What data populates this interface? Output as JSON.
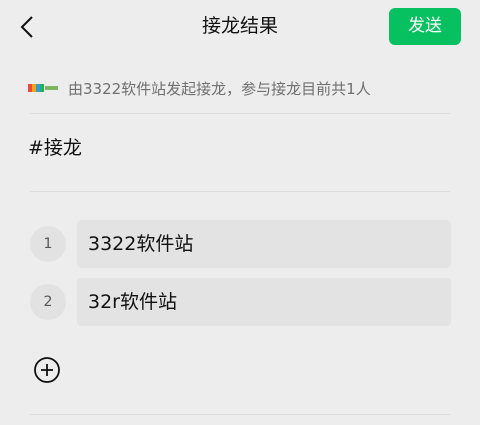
{
  "nav": {
    "title": "接龙结果",
    "send_label": "发送"
  },
  "info": {
    "logo_icon": "3322-logo-icon",
    "text": "由3322软件站发起接龙，参与接龙目前共1人"
  },
  "topic": "#接龙",
  "entries": [
    {
      "index": "1",
      "text": "3322软件站"
    },
    {
      "index": "2",
      "text": "32r软件站"
    }
  ],
  "colors": {
    "accent": "#07c160",
    "background": "#ededed"
  }
}
